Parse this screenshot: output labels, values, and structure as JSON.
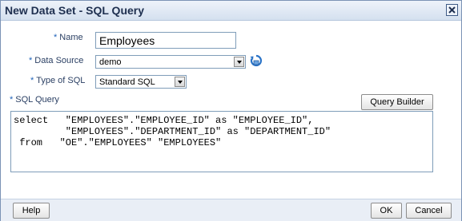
{
  "dialog": {
    "title": "New Data Set - SQL Query"
  },
  "form": {
    "name_label": "Name",
    "name_value": "Employees",
    "data_source_label": "Data Source",
    "data_source_value": "demo",
    "type_label": "Type of SQL",
    "type_value": "Standard SQL",
    "sql_label": "SQL Query",
    "required_marker": "*",
    "sql_lines": [
      "select   \"EMPLOYEES\".\"EMPLOYEE_ID\" as \"EMPLOYEE_ID\",",
      "         \"EMPLOYEES\".\"DEPARTMENT_ID\" as \"DEPARTMENT_ID\"",
      " from   \"OE\".\"EMPLOYEES\" \"EMPLOYEES\""
    ]
  },
  "buttons": {
    "query_builder": "Query Builder",
    "help": "Help",
    "ok": "OK",
    "cancel": "Cancel"
  },
  "icons": {
    "close": "close-icon",
    "refresh": "refresh-icon"
  }
}
